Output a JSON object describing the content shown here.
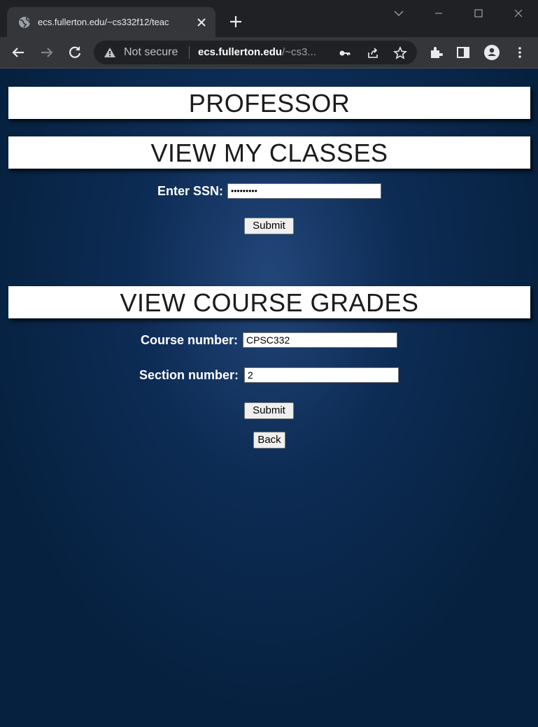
{
  "browser": {
    "tab": {
      "title": "ecs.fullerton.edu/~cs332f12/teac"
    },
    "address_bar": {
      "security_label": "Not secure",
      "host": "ecs.fullerton.edu",
      "path": "/~cs3..."
    }
  },
  "page": {
    "title": "PROFESSOR",
    "view_classes": {
      "heading": "VIEW MY CLASSES",
      "ssn_label": "Enter SSN:",
      "ssn_value": "•••••••••",
      "submit_label": "Submit"
    },
    "view_grades": {
      "heading": "VIEW COURSE GRADES",
      "course_label": "Course number:",
      "course_value": "CPSC332",
      "section_label": "Section number:",
      "section_value": "2",
      "submit_label": "Submit"
    },
    "back_label": "Back"
  },
  "colors": {
    "page_background": "#0d2c55",
    "banner_background": "#ffffff"
  }
}
